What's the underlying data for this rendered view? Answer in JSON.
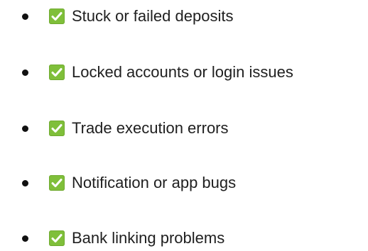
{
  "list": {
    "items": [
      {
        "label": "Stuck or failed deposits",
        "icon": "check-mark-button-icon"
      },
      {
        "label": "Locked accounts or login issues",
        "icon": "check-mark-button-icon"
      },
      {
        "label": "Trade execution errors",
        "icon": "check-mark-button-icon"
      },
      {
        "label": "Notification or app bugs",
        "icon": "check-mark-button-icon"
      },
      {
        "label": "Bank linking problems",
        "icon": "check-mark-button-icon"
      }
    ]
  },
  "colors": {
    "check_background": "#7fbf3a",
    "check_mark": "#ffffff",
    "bullet": "#111111",
    "text": "#202020"
  }
}
